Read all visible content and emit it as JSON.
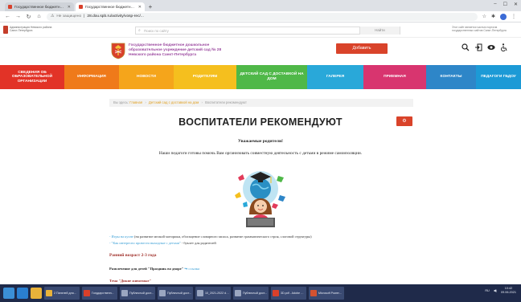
{
  "browser": {
    "tabs": [
      {
        "title": "Государственное бюджетное...",
        "active": false
      },
      {
        "title": "Государственное бюджетное...",
        "active": true
      }
    ],
    "new_tab": "+",
    "insecure_label": "Не защищено",
    "url": "28.dou.spb.ru/activity/vosp-rec/..."
  },
  "site_top": {
    "mini_org": "Администрация Невского района Санкт-Петербурга",
    "search_placeholder": "Поиск по сайту",
    "search_button": "Найти",
    "right_note": "Этот сайт является частью портала государственных сайтов Санкт-Петербурга"
  },
  "header": {
    "org_name": "Государственное бюджетное дошкольное образовательное учреждение детский сад № 28 Невского района Санкт-Петербурга",
    "add_button": "Добавить"
  },
  "menu": [
    {
      "label": "СВЕДЕНИЯ ОБ ОБРАЗОВАТЕЛЬНОЙ ОРГАНИЗАЦИИ",
      "color": "#e23327"
    },
    {
      "label": "ИНФОРМАЦИЯ",
      "color": "#ef7a1a"
    },
    {
      "label": "НОВОСТИ",
      "color": "#f5a51b"
    },
    {
      "label": "РОДИТЕЛЯМ",
      "color": "#f5bf1e"
    },
    {
      "label": "ДЕТСКИЙ САД С ДОСТАВКОЙ НА ДОМ",
      "color": "#4fb848"
    },
    {
      "label": "ГАЛЕРЕЯ",
      "color": "#29a8d9"
    },
    {
      "label": "ПРИЕМНАЯ",
      "color": "#d8356f"
    },
    {
      "label": "КОНТАКТЫ",
      "color": "#2e86c8"
    },
    {
      "label": "ПЕДАГОГИ ГБДОУ",
      "color": "#1c9ad6"
    }
  ],
  "breadcrumb": {
    "prefix": "Вы здесь:",
    "items": [
      "Главная",
      "Детский сад с доставкой на дом",
      "Воспитатели рекомендуют"
    ]
  },
  "page": {
    "title": "ВОСПИТАТЕЛИ РЕКОМЕНДУЮТ",
    "greeting": "Уважаемые родители!",
    "intro": "Наши педагоги готовы помочь Вам организовать совместную деятельность с детьми в режиме самоизоляции.",
    "line1_link": "- Игры на кухне",
    "line1_text": " (на развитие мелкой моторики, обогащение словарного запаса, развитие грамматического строя, слоговой структуры)",
    "line2_link": "- \"Как интересно провести выходные с детьми\"",
    "line2_text": " - буклет для родителей",
    "age_group": "Ранний возраст 2-3 года",
    "entertainment_text": "Развлечение для детей \"Праздник во дворе\"",
    "entertainment_link": "ссылка",
    "topic": "Тема \"Дикие животные\""
  },
  "taskbar": {
    "apps": [
      {
        "label": "2 Панелей для...",
        "color": "#e8b23a"
      },
      {
        "label": "Государственн...",
        "color": "#d9402b"
      },
      {
        "label": "Публичный дост...",
        "color": "#9aa6c0"
      },
      {
        "label": "Публичный дост...",
        "color": "#9aa6c0"
      },
      {
        "label": "10_2021-2022 ds...",
        "color": "#9aa6c0"
      },
      {
        "label": "Публичный дост...",
        "color": "#9aa6c0"
      },
      {
        "label": "3D.pdf - Adobe R...",
        "color": "#d9402b"
      },
      {
        "label": "Microsoft PowerP...",
        "color": "#d35230"
      }
    ],
    "lang": "RU",
    "time": "10:42",
    "date": "09.06.2021"
  }
}
